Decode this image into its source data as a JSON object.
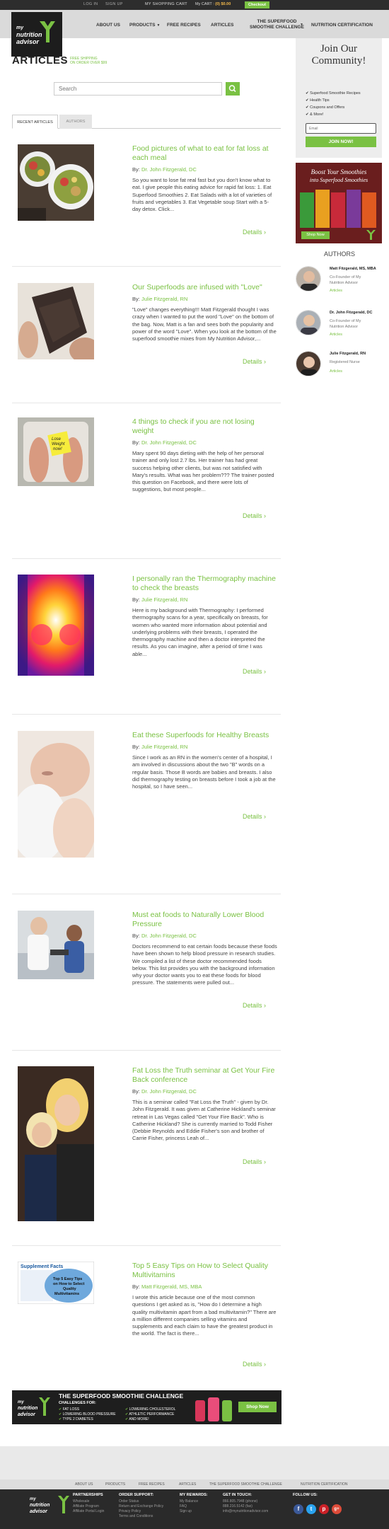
{
  "topbar": {
    "login": "LOG IN",
    "signup": "SIGN UP",
    "shopping_cart": "MY SHOPPING CART",
    "cart_label": "My CART :",
    "cart_value": "(0) $0.00",
    "checkout": "Checkout"
  },
  "brand": {
    "line1": "my",
    "line2": "nutrition",
    "line3": "advisor"
  },
  "nav": {
    "about": "ABOUT US",
    "products": "PRODUCTS",
    "recipes": "FREE RECIPES",
    "articles": "ARTICLES",
    "challenge_l1": "THE SUPERFOOD",
    "challenge_l2": "SMOOTHIE CHALLENGE",
    "certification": "NUTRITION CERTIFICATION"
  },
  "page": {
    "title": "ARTICLES",
    "ship_l1": "FREE SHIPPING",
    "ship_l2": "ON ORDER OVER $99",
    "search_placeholder": "Search",
    "tab_recent": "RECENT ARTICLES",
    "tab_authors": "AUTHORS",
    "details": "Details"
  },
  "articles": [
    {
      "title": "Food pictures of what to eat for fat loss at each meal",
      "by": "By:",
      "author": "Dr. John Fitzgerald, DC",
      "excerpt": "So you want to lose fat real fast but you don't know what to eat.  I give people this eating advice for rapid fat loss: 1. Eat Superfood Smoothies 2. Eat Salads with a lot of varieties of fruits and vegetables 3. Eat Vegetable soup   Start with a 5-day detox.  Click..."
    },
    {
      "title": "Our Superfoods are infused with \"Love\"",
      "by": "By:",
      "author": "Julie Fitzgerald, RN",
      "excerpt": "\"Love\" changes everything!!! Matt Fitzgerald thought I was crazy when I wanted to put the word \"Love\" on the bottom of the bag. Now, Matt is a fan and sees both the popularity and power of the word \"Love\". When you look at the bottom of the superfood smoothie mixes from My Nutrition Advisor,..."
    },
    {
      "title": "4 things to check if you are not losing weight",
      "by": "By:",
      "author": "Dr. John Fitzgerald, DC",
      "excerpt": "Mary spent 90 days dieting with the help of her personal trainer and only lost 2.7 lbs.  Her trainer has had great success helping other clients, but was not satisfied with Mary's results. What was her problem??? The trainer posted this question on Facebook, and there were lots of suggestions, but most people..."
    },
    {
      "title": "I personally ran the Thermography machine to check the breasts",
      "by": "By:",
      "author": "Julie Fitzgerald, RN",
      "excerpt": "Here is my background with Thermography: I performed thermography scans for a year, specifically on breasts, for women who wanted more information about potential and underlying problems with their breasts, I operated the thermography machine and then a doctor interpreted the results. As you can imagine, after a period of time I was able..."
    },
    {
      "title": "Eat these Superfoods for Healthy Breasts",
      "by": "By:",
      "author": "Julie Fitzgerald, RN",
      "excerpt": "Since I work as an RN in the women's center of a hospital, I am involved in discussions about the two \"B\" words on a regular basis. Those B words are babies and breasts. I also did thermography testing on breasts before I took a job at the hospital, so I have seen..."
    },
    {
      "title": "Must eat foods to Naturally Lower Blood Pressure",
      "by": "By:",
      "author": "Dr. John Fitzgerald, DC",
      "excerpt": "Doctors recommend to eat certain foods because these foods have been shown to help blood pressure in research studies. We compiled a list of these doctor recommended foods below.  This list provides you with the background information why your doctor wants you to eat these foods for blood pressure.  The statements were pulled out..."
    },
    {
      "title": "Fat Loss the Truth seminar at Get Your Fire Back conference",
      "by": "By:",
      "author": "Dr. John Fitzgerald, DC",
      "excerpt": "This is a seminar called \"Fat Loss the Truth\" - given by Dr. John Fitzgerald.  It was given at Catherine Hickland's seminar retreat in Las Vegas called \"Get Your Fire Back\".   Who is Catherine Hickland? She is currently married to Todd Fisher (Debbie Reynolds and Eddie Fisher's son and brother of Carrie Fisher, princess Leah of..."
    },
    {
      "title": "Top 5 Easy Tips on How to Select Quality Multivitamins",
      "by": "By:",
      "author": "Matt Fitzgerald, MS, MBA",
      "excerpt": "I wrote this article because one of the most common questions I get asked as is, \"How do I determine a high quality multivitamin apart from a bad multivitamin?\" There are a million different companies selling vitamins and supplements and each claim to have the greatest product in the world. The fact is there..."
    }
  ],
  "thumb_text": {
    "scale_l1": "Lose",
    "scale_l2": "Weight",
    "scale_l3": "now!",
    "supp_title": "Supplement Facts",
    "supp_l1": "Top 5 Easy Tips",
    "supp_l2": "on How to Select",
    "supp_l3": "Quality",
    "supp_l4": "Multivitamins"
  },
  "cta": {
    "title": "THE SUPERFOOD SMOOTHIE CHALLENGE",
    "for": "CHALLENGES FOR:",
    "items": [
      "FAT LOSS",
      "LOWERING BLOOD PRESSURE",
      "TYPE 2 DIABETES",
      "LOWERING CHOLESTEROL",
      "ATHLETIC PERFORMANCE",
      "AND MORE!"
    ],
    "button": "Shop Now"
  },
  "sidebar": {
    "join_l1": "Join Our",
    "join_l2": "Community!",
    "join_items": [
      "Superfood Smoothie Recipes",
      "Health Tips",
      "Coupons and Offers",
      "& More!"
    ],
    "email_placeholder": "Email",
    "join_button": "JOIN NOW!",
    "boost_l1": "Boost Your Smoothies",
    "boost_l2": "into Superfood Smoothies",
    "boost_button": "Shop Now",
    "authors_heading": "AUTHORS",
    "authors": [
      {
        "name": "Matt Fitzgerald, MS, MBA",
        "role_l1": "Co-Founder of My",
        "role_l2": "Nutrition Advisor",
        "link": "Articles"
      },
      {
        "name": "Dr. John Fitzgerald, DC",
        "role_l1": "Co-Founder of My",
        "role_l2": "Nutrition Advisor",
        "link": "Articles"
      },
      {
        "name": "Julie Fitzgerald, RN",
        "role_l1": "Registered Nurse",
        "role_l2": "",
        "link": "Articles"
      }
    ]
  },
  "footer": {
    "nav": [
      "ABOUT US",
      "PRODUCTS",
      "FREE RECIPES",
      "ARTICLES",
      "THE SUPERFOOD SMOOTHIE CHALLENGE",
      "NUTRITION CERTIFICATION"
    ],
    "partnerships_h": "PARTNERSHIPS",
    "partnerships": [
      "Wholesale",
      "Affiliate Program",
      "Affiliate Portal Login"
    ],
    "support_h": "ORDER SUPPORT:",
    "support": [
      "Order Status",
      "Return and Exchange Policy",
      "Privacy Policy",
      "Terms and Conditions"
    ],
    "rewards_h": "MY REWARDS:",
    "rewards": [
      "My Balance",
      "FAQ",
      "Sign up"
    ],
    "touch_h": "GET IN TOUCH:",
    "touch": [
      "866.805.7948 (phone)",
      "888.216.5142 (fax)",
      "info@mynutritionadvisor.com"
    ],
    "follow_h": "FOLLOW US:",
    "social": {
      "facebook": "f",
      "twitter": "t",
      "pinterest": "p",
      "google": "g+"
    }
  },
  "colors": {
    "accent": "#7ac143",
    "dark": "#1e1e1e"
  }
}
